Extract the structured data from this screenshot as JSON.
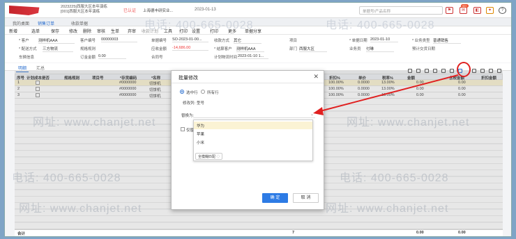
{
  "header": {
    "account_line1": "2023225|西服大区本年演练",
    "account_line2": "[001]西服大区本年演练",
    "cert": "已认证",
    "company": "上海德丰研实业...",
    "date": "2023-01-13",
    "search_placeholder": "单据号/产品名称",
    "badge_count": "99+"
  },
  "tabs": [
    "我的桌面",
    "销售订单",
    "收款单据"
  ],
  "active_tab": "销售订单",
  "toolbar": [
    "新增",
    "选单",
    "保存",
    "修改",
    "删除",
    "审核",
    "生单",
    "弃审",
    "收款计划",
    "工具",
    "打印",
    "设置",
    "打印",
    "更多",
    "单据分享"
  ],
  "form": {
    "customer_label": "* 客户",
    "customer_value": "测样机AAA",
    "customer_code_label": "客户编号",
    "customer_code_value": "00000003",
    "order_no_label": "单据编号",
    "order_no_value": "SO-2023-01-00...",
    "payment_label": "收款方式",
    "payment_value": "其它",
    "project_label": "项目",
    "date_label": "* 单据日期",
    "date_value": "2023-01-10",
    "biz_type_label": "* 业务类型",
    "biz_type_value": "普通销售",
    "delivery_label": "* 配送方式",
    "delivery_value": "三方物流",
    "spec_label": "规格规则",
    "receivable_label": "应收金额",
    "receivable_value": "-14,686.00",
    "settle_label": "* 结算客户",
    "settle_value": "测样机AAA",
    "dept_label": "部门",
    "dept_value": "西服大区",
    "salesman_label": "业务员",
    "salesman_value": "付琳",
    "expected_label": "预计交货日期",
    "vehicle_label": "车辆信息",
    "deposit_label": "订金金额",
    "deposit_value": "0.00",
    "contract_label": "合同号",
    "plan_label": "计划物流时间",
    "plan_value": "2023-01-10 1..."
  },
  "detail_tabs": [
    "明细",
    "汇总"
  ],
  "grid": {
    "headers": [
      "序号",
      "计划成本是否",
      "规格规则",
      "项目号",
      "*存货编码",
      "*名称",
      "*规格型号",
      "数量",
      "折扣%",
      "单价",
      "税率%",
      "金额",
      "含税金额",
      "折扣金额"
    ],
    "rows": [
      {
        "no": "1",
        "code": "#0000000",
        "name": "切饼机",
        "discount": "100.00%",
        "price": "0.0000",
        "tax": "13.00%",
        "amount": "0.00",
        "tax_amount": "0.00"
      },
      {
        "no": "2",
        "code": "#0000000",
        "name": "切饼机",
        "discount": "100.00%",
        "price": "0.0000",
        "tax": "13.00%",
        "amount": "0.00",
        "tax_amount": "0.00"
      },
      {
        "no": "3",
        "code": "#0000000",
        "name": "切饼机",
        "discount": "100.00%",
        "price": "0.0000",
        "tax": "13.00%",
        "amount": "0.00",
        "tax_amount": "0.00"
      }
    ],
    "total_label": "合计",
    "total_qty": "7",
    "total_amount": "0.00",
    "total_tax_amount": "0.00"
  },
  "dialog": {
    "title": "批量修改",
    "radio_selected": "选中行",
    "radio_all": "所有行",
    "column_label": "修改列:",
    "column_value": "型号",
    "replace_label": "替换为:",
    "options": [
      "华为",
      "苹果",
      "小米"
    ],
    "match_button": "全模糊匹配",
    "only_label": "仅替",
    "ok": "确 定",
    "cancel": "取 消"
  },
  "watermark": {
    "phone": "电话: 400-665-0028",
    "site": "网址: www.chanjet.net"
  },
  "colors": {
    "accent": "#2d7be5",
    "highlight": "#fbf3d4",
    "annotation": "#e02020"
  }
}
